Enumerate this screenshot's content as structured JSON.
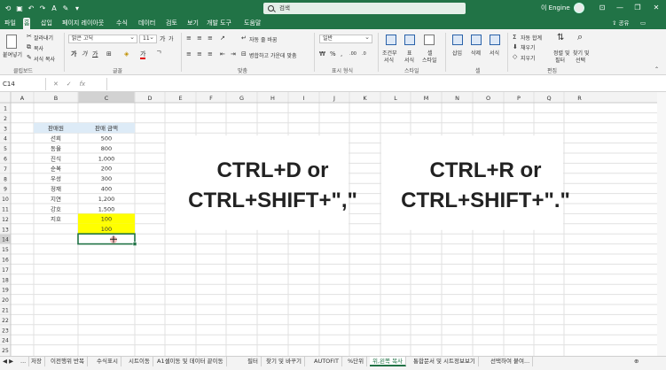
{
  "title_bar": {
    "search_placeholder": "검색",
    "user_name": "이 Engine",
    "minimize": "—",
    "restore": "❐",
    "close": "✕"
  },
  "menu": [
    "파일",
    "홈",
    "삽입",
    "페이지 레이아웃",
    "수식",
    "데이터",
    "검토",
    "보기",
    "개발 도구",
    "도움말"
  ],
  "menu_active": "홈",
  "share_label": "공유",
  "ribbon": {
    "clipboard": {
      "paste": "붙여넣기",
      "cut": "잘라내기",
      "copy": "복사",
      "format_painter": "서식 복사",
      "group": "클립보드"
    },
    "font": {
      "name": "맑은 고딕",
      "size": "11",
      "group": "글꼴",
      "grow": "가",
      "shrink": "가",
      "bold": "가",
      "italic": "가",
      "underline": "가",
      "font_color": "가"
    },
    "alignment": {
      "wrap": "자동 줄 바꿈",
      "merge": "병합하고 가운데 맞춤",
      "group": "맞춤"
    },
    "number": {
      "format": "일반",
      "group": "표시 형식"
    },
    "styles": {
      "conditional": "조건부",
      "conditional2": "서식",
      "table": "표",
      "table2": "서식",
      "cell": "셀",
      "cell2": "스타일",
      "group": "스타일"
    },
    "cells": {
      "insert": "삽입",
      "delete": "삭제",
      "format": "서식",
      "group": "셀"
    },
    "editing": {
      "autosum": "자동 합계",
      "fill": "채우기",
      "clear": "지우기",
      "sort": "정렬 및",
      "sort2": "필터",
      "find": "찾기 및",
      "find2": "선택",
      "group": "편집"
    }
  },
  "formula_bar": {
    "name_box": "C14",
    "cancel": "✕",
    "enter": "✓",
    "fx": "fx",
    "value": ""
  },
  "columns": [
    "A",
    "B",
    "C",
    "D",
    "E",
    "F",
    "G",
    "H",
    "I",
    "J",
    "K",
    "L",
    "M",
    "N",
    "O",
    "P",
    "Q",
    "R"
  ],
  "rows": [
    "1",
    "2",
    "3",
    "4",
    "5",
    "6",
    "7",
    "8",
    "9",
    "10",
    "11",
    "12",
    "13",
    "14",
    "15",
    "16",
    "17",
    "18",
    "19",
    "20",
    "21",
    "22",
    "23",
    "24",
    "25"
  ],
  "table": {
    "header_name": "판매원",
    "header_amount": "판매 금액",
    "header_fill": "#ddebf7",
    "highlight_fill": "#ffff00",
    "rows": [
      {
        "name": "선희",
        "amount": "500"
      },
      {
        "name": "동율",
        "amount": "800"
      },
      {
        "name": "진식",
        "amount": "1,000"
      },
      {
        "name": "순복",
        "amount": "200"
      },
      {
        "name": "우성",
        "amount": "300"
      },
      {
        "name": "정재",
        "amount": "400"
      },
      {
        "name": "지연",
        "amount": "1,200"
      },
      {
        "name": "강호",
        "amount": "1,500"
      },
      {
        "name": "지효",
        "amount": "100",
        "highlight": true
      },
      {
        "name": "",
        "amount": "100",
        "highlight": true
      }
    ]
  },
  "active_cell": "C14",
  "overlay_left": {
    "line1": "CTRL+D or",
    "line2": "CTRL+SHIFT+\",\""
  },
  "overlay_right": {
    "line1": "CTRL+R or",
    "line2": "CTRL+SHIFT+\".\""
  },
  "sheet_tabs": [
    "...",
    "저장",
    "이전행위 반복",
    "수식표시",
    "시트이동",
    "A1셀이동 및 데이터 끝이동",
    "필터",
    "찾기 및 바꾸기",
    "AUTOFIT",
    "%단위",
    "위,왼쪽 복사",
    "통합문서 및 시트정보보기",
    "선택하여 붙여..."
  ],
  "active_tab": "위,왼쪽 복사",
  "colors": {
    "excel_green": "#217346",
    "grid_line": "#e1e1e1",
    "selection": "#217346"
  }
}
